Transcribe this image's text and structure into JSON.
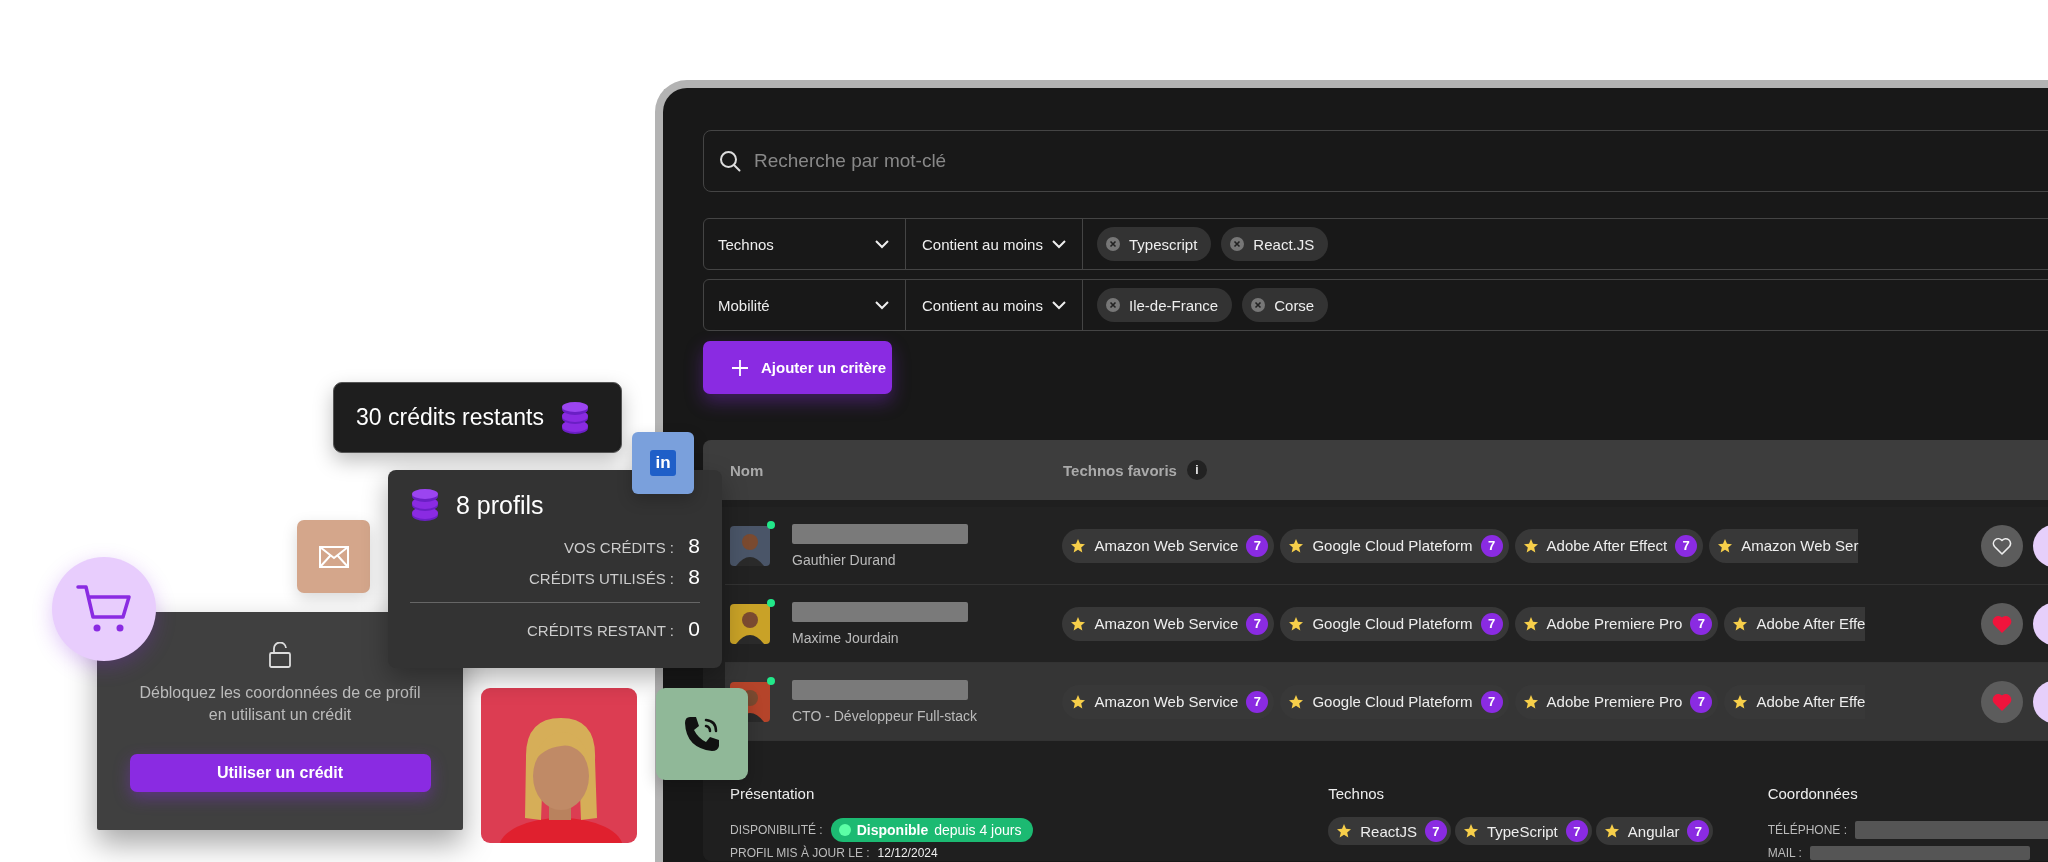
{
  "credits_badge": {
    "text": "30 crédits restants"
  },
  "linkedin_badge": {
    "text": "in"
  },
  "profiles_card": {
    "title": "8 profils",
    "lines": [
      {
        "label": "VOS CRÉDITS :",
        "value": "8"
      },
      {
        "label": "CRÉDITS UTILISÉS :",
        "value": "8"
      },
      {
        "label": "CRÉDITS RESTANT :",
        "value": "0"
      }
    ]
  },
  "unlock_card": {
    "text": "Débloquez les coordonnées de ce profil en utilisant un crédit",
    "button": "Utiliser un crédit"
  },
  "search": {
    "placeholder": "Recherche par mot-clé"
  },
  "filters": [
    {
      "field": "Technos",
      "operator": "Contient au moins",
      "tags": [
        "Typescript",
        "React.JS"
      ]
    },
    {
      "field": "Mobilité",
      "operator": "Contient au moins",
      "tags": [
        "Ile-de-France",
        "Corse"
      ]
    }
  ],
  "add_button": "Ajouter un critère",
  "table": {
    "columns": [
      {
        "label": "Nom"
      },
      {
        "label": "Technos favoris",
        "info": "i"
      }
    ],
    "rows": [
      {
        "subtitle": "Gauthier Durand",
        "online": true,
        "selected": false,
        "favorite": false,
        "technos": [
          {
            "label": "Amazon Web Service",
            "count": "7"
          },
          {
            "label": "Google Cloud Plateform",
            "count": "7"
          },
          {
            "label": "Adobe After Effect",
            "count": "7"
          },
          {
            "label": "Amazon Web Ser"
          }
        ]
      },
      {
        "subtitle": "Maxime Jourdain",
        "online": true,
        "selected": false,
        "favorite": true,
        "technos": [
          {
            "label": "Amazon Web Service",
            "count": "7"
          },
          {
            "label": "Google Cloud Plateform",
            "count": "7"
          },
          {
            "label": "Adobe Premiere Pro",
            "count": "7"
          },
          {
            "label": "Adobe After Effe"
          }
        ]
      },
      {
        "subtitle": "CTO - Développeur Full-stack",
        "online": true,
        "selected": true,
        "favorite": true,
        "technos": [
          {
            "label": "Amazon Web Service",
            "count": "7"
          },
          {
            "label": "Google Cloud Plateform",
            "count": "7"
          },
          {
            "label": "Adobe Premiere Pro",
            "count": "7"
          },
          {
            "label": "Adobe After Effe"
          }
        ]
      }
    ]
  },
  "details": {
    "presentation": {
      "title": "Présentation",
      "availability_label": "DISPONIBILITÉ :",
      "availability": "**Disponible** depuis 4 jours",
      "updated_label": "PROFIL MIS À JOUR LE :",
      "updated": "12/12/2024"
    },
    "technos": {
      "title": "Technos",
      "tags": [
        {
          "label": "ReactJS",
          "count": "7"
        },
        {
          "label": "TypeScript",
          "count": "7"
        },
        {
          "label": "Angular",
          "count": "7"
        }
      ]
    },
    "contact": {
      "title": "Coordonnées",
      "lines": [
        {
          "label": "TÉLÉPHONE :"
        },
        {
          "label": "MAIL :"
        }
      ]
    }
  }
}
